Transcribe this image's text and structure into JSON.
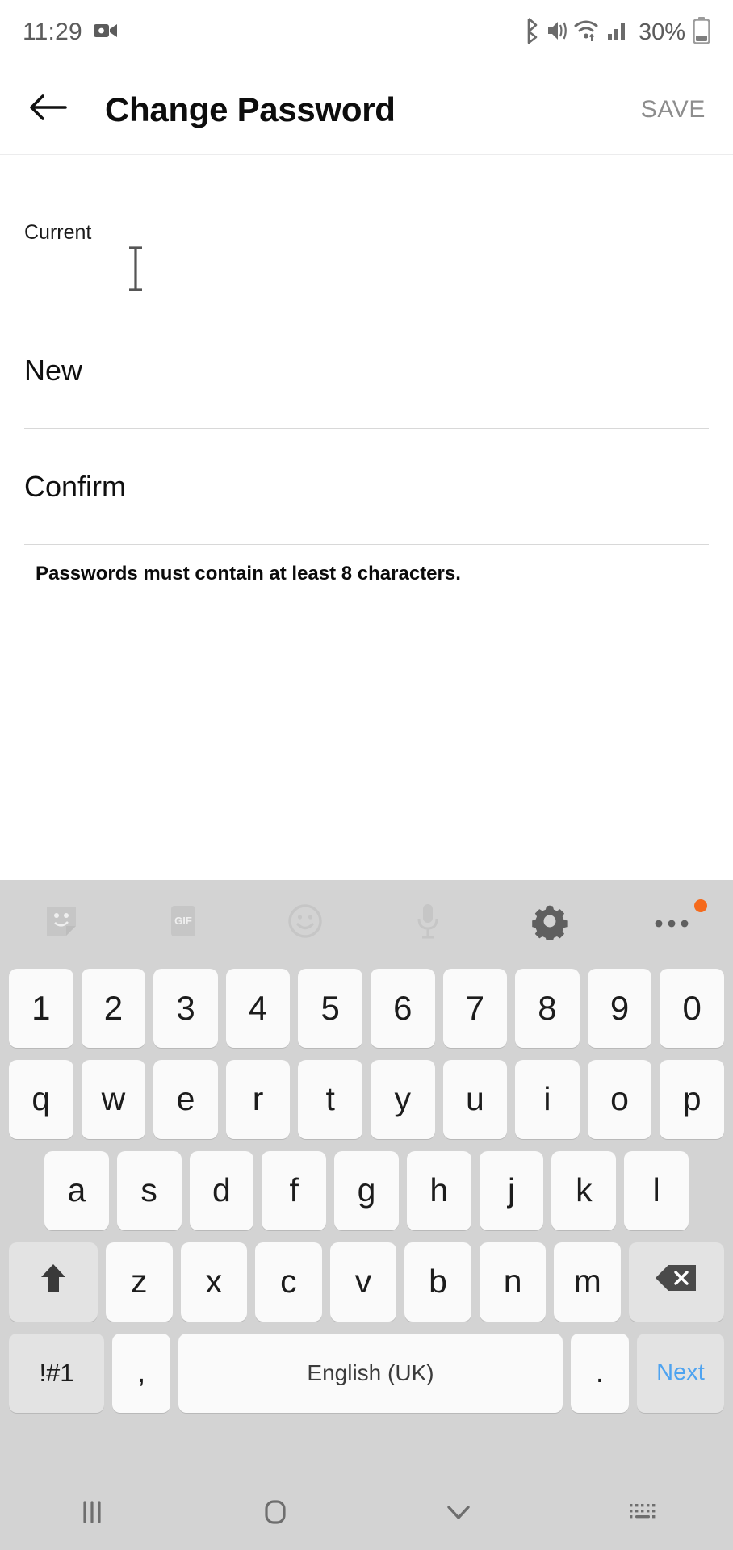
{
  "status_bar": {
    "time": "11:29",
    "battery_percent": "30%",
    "icons": [
      "screen-record-icon",
      "bluetooth-icon",
      "mute-vibrate-icon",
      "wifi-icon",
      "signal-bars-icon",
      "battery-icon"
    ]
  },
  "app_bar": {
    "back_icon": "back-arrow-icon",
    "title": "Change Password",
    "save_label": "SAVE",
    "save_color": "#8d8d8d"
  },
  "form": {
    "fields": [
      {
        "label": "Current",
        "value": "",
        "state": "focused"
      },
      {
        "label": "New",
        "value": "",
        "state": "empty"
      },
      {
        "label": "Confirm",
        "value": "",
        "state": "empty"
      }
    ],
    "helper_text": "Passwords must contain at least 8 characters."
  },
  "cursor": {
    "type": "i-beam-cursor"
  },
  "keyboard": {
    "background": "#d3d3d3",
    "key_color": "#fafafa",
    "mod_key_color": "#e3e3e3",
    "toolbar": [
      {
        "name": "sticker-icon",
        "label": ""
      },
      {
        "name": "gif-icon",
        "label": "GIF"
      },
      {
        "name": "emoji-icon",
        "label": ""
      },
      {
        "name": "microphone-icon",
        "label": ""
      },
      {
        "name": "gear-icon",
        "label": ""
      },
      {
        "name": "more-options-icon",
        "label": "",
        "badge": true
      }
    ],
    "badge_color": "#f56a1c",
    "rows": {
      "numbers": [
        "1",
        "2",
        "3",
        "4",
        "5",
        "6",
        "7",
        "8",
        "9",
        "0"
      ],
      "top": [
        "q",
        "w",
        "e",
        "r",
        "t",
        "y",
        "u",
        "i",
        "o",
        "p"
      ],
      "home": [
        "a",
        "s",
        "d",
        "f",
        "g",
        "h",
        "j",
        "k",
        "l"
      ],
      "bottom": [
        "z",
        "x",
        "c",
        "v",
        "b",
        "n",
        "m"
      ]
    },
    "shift_icon": "shift-up-arrow-icon",
    "backspace_icon": "backspace-icon",
    "symbols_label": "!#1",
    "comma_label": ",",
    "space_label": "English (UK)",
    "period_label": ".",
    "next_label": "Next",
    "next_color": "#4ea3f0"
  },
  "nav_bar": {
    "items": [
      "recents-icon",
      "home-icon",
      "hide-keyboard-icon",
      "keyboard-switch-icon"
    ]
  }
}
